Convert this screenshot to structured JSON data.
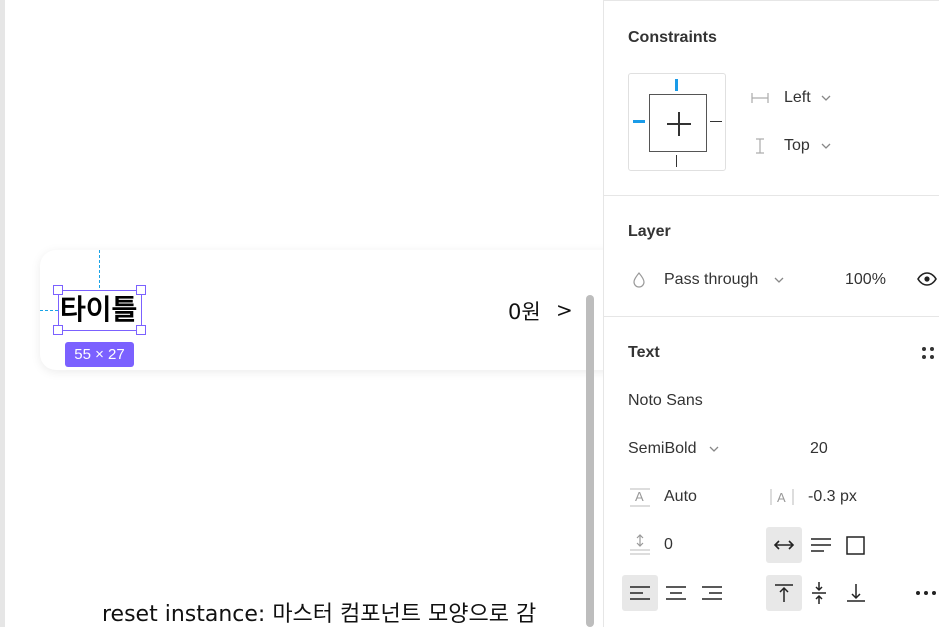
{
  "canvas": {
    "card": {
      "title": "타이틀",
      "size_label": "55 × 27",
      "price": "0원",
      "chevron": ">"
    },
    "caption": "reset instance: 마스터 컴포넌트 모양으로 감"
  },
  "panel": {
    "constraints": {
      "title": "Constraints",
      "horizontal": "Left",
      "vertical": "Top"
    },
    "layer": {
      "title": "Layer",
      "blend_mode": "Pass through",
      "opacity": "100%"
    },
    "text": {
      "title": "Text",
      "font_family": "Noto Sans",
      "font_weight": "SemiBold",
      "font_size": "20",
      "line_height": "Auto",
      "letter_spacing": "-0.3 px",
      "paragraph_spacing": "0"
    }
  },
  "colors": {
    "selection": "#7b61ff",
    "constraint_active": "#1a9be8",
    "guide": "#1aa3e6"
  }
}
